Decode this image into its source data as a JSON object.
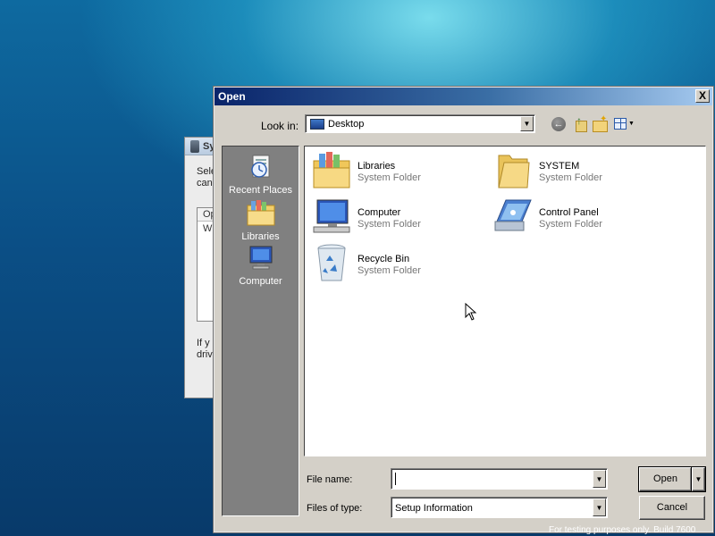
{
  "background_dialog": {
    "title": "Sy",
    "line1": "Sele",
    "line2": "can",
    "list_header": "Op",
    "list_row": "W",
    "footer1": "If y",
    "footer2": "driv"
  },
  "dialog": {
    "title": "Open",
    "close_label": "X",
    "look_in_label": "Look in:",
    "look_in_value": "Desktop",
    "places": [
      {
        "label": "Recent Places",
        "icon": "recent-places-icon"
      },
      {
        "label": "Libraries",
        "icon": "libraries-icon"
      },
      {
        "label": "Computer",
        "icon": "computer-icon"
      }
    ],
    "items": [
      {
        "name": "Libraries",
        "type": "System Folder",
        "icon": "libraries-folder-icon"
      },
      {
        "name": "SYSTEM",
        "type": "System Folder",
        "icon": "folder-icon"
      },
      {
        "name": "Computer",
        "type": "System Folder",
        "icon": "computer-icon"
      },
      {
        "name": "Control Panel",
        "type": "System Folder",
        "icon": "control-panel-icon"
      },
      {
        "name": "Recycle Bin",
        "type": "System Folder",
        "icon": "recycle-bin-icon"
      }
    ],
    "file_name_label": "File name:",
    "file_name_value": "",
    "files_of_type_label": "Files of type:",
    "files_of_type_value": "Setup Information",
    "open_label": "Open",
    "cancel_label": "Cancel"
  },
  "watermark_text": "For testing purposes only. Build 7600"
}
